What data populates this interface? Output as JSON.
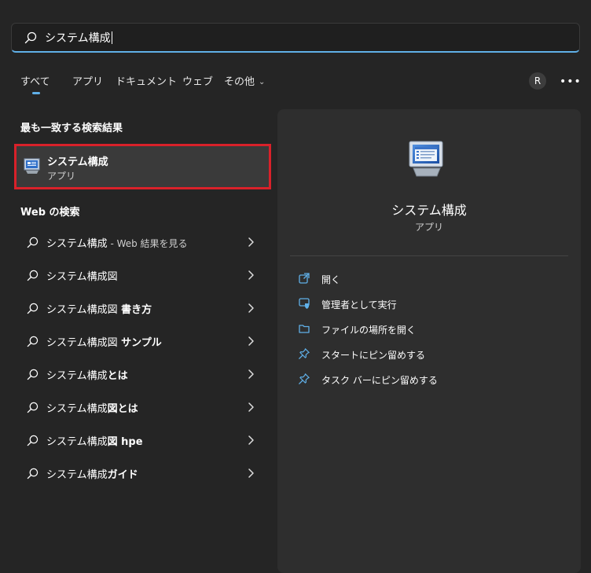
{
  "search": {
    "query": "システム構成"
  },
  "tabs": [
    {
      "label": "すべて"
    },
    {
      "label": "アプリ"
    },
    {
      "label": "ドキュメント"
    },
    {
      "label": "ウェブ"
    },
    {
      "label": "その他"
    }
  ],
  "user": {
    "avatar_initial": "R"
  },
  "more_label": "•••",
  "best_match": {
    "section_title": "最も一致する検索結果",
    "name": "システム構成",
    "type": "アプリ",
    "highlight_color": "#d9212a"
  },
  "web_search": {
    "section_title": "Web の検索",
    "items": [
      {
        "prefix": "システム構成",
        "bold": "",
        "suffix": " - Web 結果を見る"
      },
      {
        "prefix": "システム構成図",
        "bold": "",
        "suffix": ""
      },
      {
        "prefix": "システム構成図",
        "bold": " 書き方",
        "suffix": ""
      },
      {
        "prefix": "システム構成図",
        "bold": " サンプル",
        "suffix": ""
      },
      {
        "prefix": "システム構成",
        "bold": "とは",
        "suffix": ""
      },
      {
        "prefix": "システム構成",
        "bold": "図とは",
        "suffix": ""
      },
      {
        "prefix": "システム構成",
        "bold": "図 hpe",
        "suffix": ""
      },
      {
        "prefix": "システム構成",
        "bold": "ガイド",
        "suffix": ""
      }
    ]
  },
  "detail": {
    "name": "システム構成",
    "type": "アプリ",
    "actions": [
      {
        "label": "開く",
        "icon": "open-external-icon"
      },
      {
        "label": "管理者として実行",
        "icon": "shield-admin-icon"
      },
      {
        "label": "ファイルの場所を開く",
        "icon": "folder-icon"
      },
      {
        "label": "スタートにピン留めする",
        "icon": "pin-icon"
      },
      {
        "label": "タスク バーにピン留めする",
        "icon": "pin-icon"
      }
    ]
  },
  "colors": {
    "accent": "#60b0e8",
    "background": "#252525",
    "panel": "#2e2e2e"
  }
}
